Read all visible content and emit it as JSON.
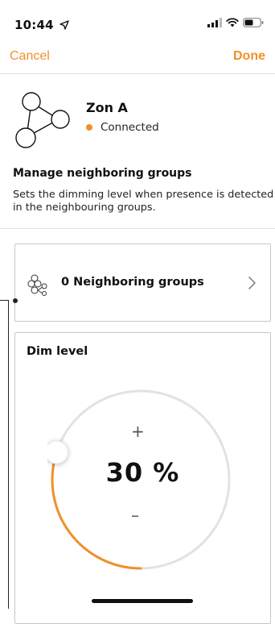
{
  "status_bar": {
    "time": "10:44"
  },
  "nav": {
    "cancel_label": "Cancel",
    "done_label": "Done"
  },
  "zone": {
    "title": "Zon A",
    "status": "Connected"
  },
  "section": {
    "title": "Manage neighboring groups",
    "description": "Sets the dimming level when presence is detected in the neighbouring groups."
  },
  "neighbor_card": {
    "label": "0 Neighboring groups"
  },
  "dim_card": {
    "title": "Dim level",
    "plus": "+",
    "value": "30 %",
    "minus": "–",
    "level_percent": 30
  },
  "colors": {
    "accent": "#f0902a",
    "track": "#e2e2e2"
  },
  "icons": {
    "location": "location-arrow-icon",
    "signal": "signal-bars-icon",
    "wifi": "wifi-icon",
    "battery": "battery-icon",
    "zone": "group-nodes-icon",
    "neighbor": "neighbor-groups-icon",
    "chevron": "chevron-right-icon"
  }
}
